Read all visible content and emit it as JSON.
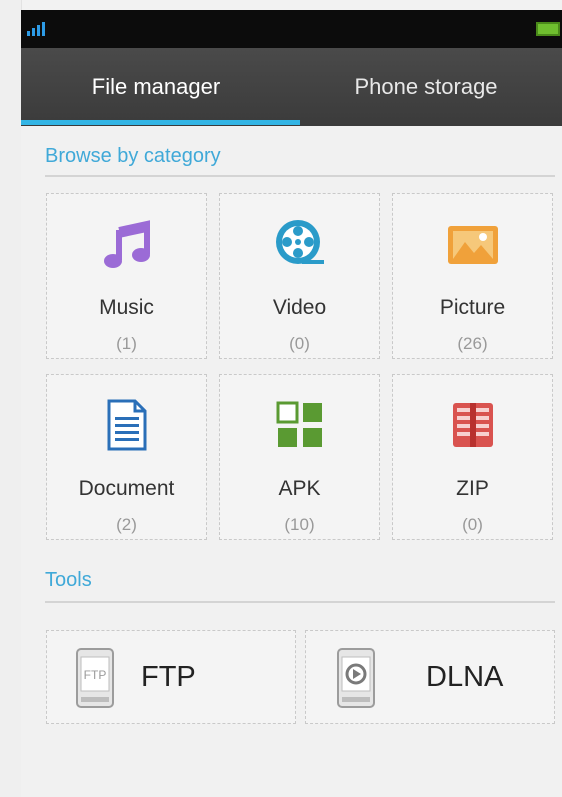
{
  "tabs": [
    {
      "label": "File manager",
      "active": true
    },
    {
      "label": "Phone storage",
      "active": false
    }
  ],
  "accent_color": "#33b5e5",
  "browse": {
    "header": "Browse by category",
    "categories": [
      {
        "name": "Music",
        "count": "(1)",
        "icon": "music-note-icon",
        "color": "#9b6bd6"
      },
      {
        "name": "Video",
        "count": "(0)",
        "icon": "film-reel-icon",
        "color": "#2a9bc9"
      },
      {
        "name": "Picture",
        "count": "(26)",
        "icon": "picture-icon",
        "color": "#f0a13a"
      },
      {
        "name": "Document",
        "count": "(2)",
        "icon": "document-icon",
        "color": "#2a6fb8"
      },
      {
        "name": "APK",
        "count": "(10)",
        "icon": "apk-grid-icon",
        "color": "#5a9a32"
      },
      {
        "name": "ZIP",
        "count": "(0)",
        "icon": "zip-archive-icon",
        "color": "#d9534f"
      }
    ]
  },
  "tools": {
    "header": "Tools",
    "items": [
      {
        "name": "FTP",
        "icon_label": "FTP",
        "icon": "ftp-phone-icon"
      },
      {
        "name": "DLNA",
        "icon": "dlna-phone-icon"
      }
    ]
  }
}
